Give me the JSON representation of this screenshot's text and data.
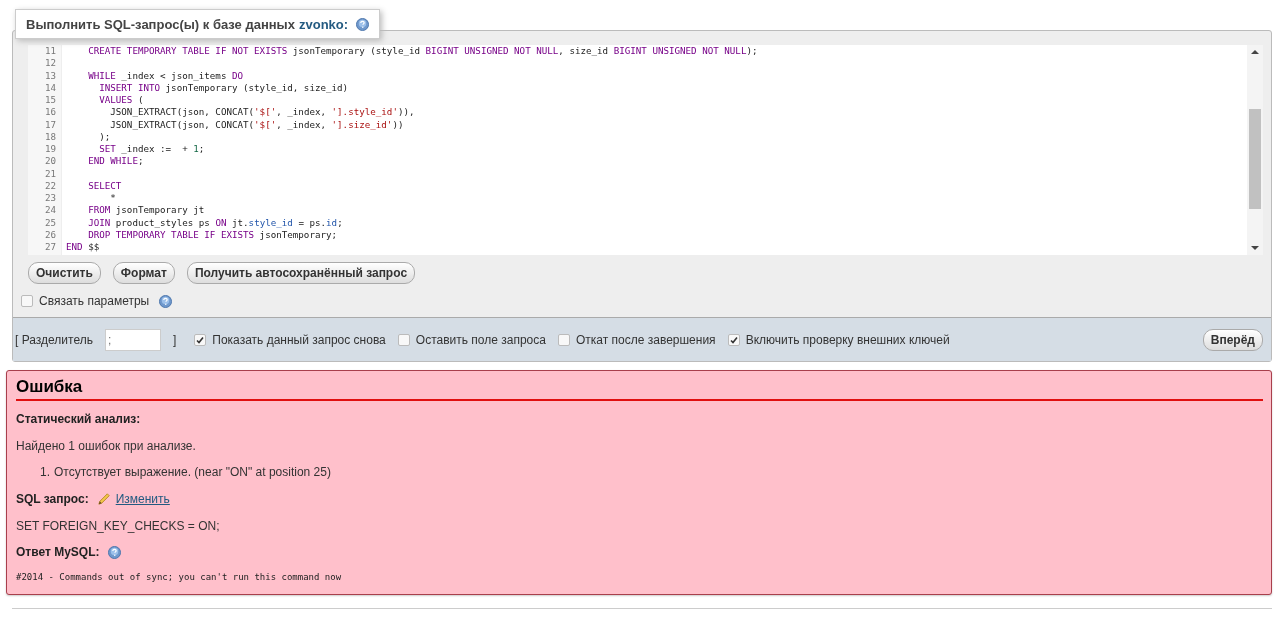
{
  "query_box": {
    "title": "Выполнить SQL-запрос(ы) к базе данных",
    "database": "zvonko:",
    "code_lines": [
      {
        "number": "11",
        "tokens": [
          {
            "kind": "kw",
            "t": "    CREATE TEMPORARY TABLE IF NOT EXISTS"
          },
          {
            "kind": "plain",
            "t": " jsonTemporary (style_id "
          },
          {
            "kind": "kw",
            "t": "BIGINT UNSIGNED NOT NULL"
          },
          {
            "kind": "plain",
            "t": ", size_id "
          },
          {
            "kind": "kw",
            "t": "BIGINT UNSIGNED NOT NULL"
          },
          {
            "kind": "plain",
            "t": ");"
          }
        ]
      },
      {
        "number": "12"
      },
      {
        "number": "13",
        "tokens": [
          {
            "kind": "kw",
            "t": "    WHILE"
          },
          {
            "kind": "plain",
            "t": " _index < json_items "
          },
          {
            "kind": "kw",
            "t": "DO"
          }
        ]
      },
      {
        "number": "14",
        "tokens": [
          {
            "kind": "kw",
            "t": "      INSERT INTO"
          },
          {
            "kind": "plain",
            "t": " jsonTemporary (style_id, size_id)"
          }
        ]
      },
      {
        "number": "15",
        "tokens": [
          {
            "kind": "kw",
            "t": "      VALUES"
          },
          {
            "kind": "plain",
            "t": " ("
          }
        ]
      },
      {
        "number": "16",
        "tokens": [
          {
            "kind": "plain",
            "t": "        JSON_EXTRACT(json, CONCAT("
          },
          {
            "kind": "str",
            "t": "'$['"
          },
          {
            "kind": "plain",
            "t": ", _index, "
          },
          {
            "kind": "str",
            "t": "'].style_id'"
          },
          {
            "kind": "plain",
            "t": ")),"
          }
        ]
      },
      {
        "number": "17",
        "tokens": [
          {
            "kind": "plain",
            "t": "        JSON_EXTRACT(json, CONCAT("
          },
          {
            "kind": "str",
            "t": "'$['"
          },
          {
            "kind": "plain",
            "t": ", _index, "
          },
          {
            "kind": "str",
            "t": "'].size_id'"
          },
          {
            "kind": "plain",
            "t": "))"
          }
        ]
      },
      {
        "number": "18",
        "tokens": [
          {
            "kind": "plain",
            "t": "      );"
          }
        ]
      },
      {
        "number": "19",
        "tokens": [
          {
            "kind": "kw",
            "t": "      SET"
          },
          {
            "kind": "plain",
            "t": " _index :=  + "
          },
          {
            "kind": "num",
            "t": "1"
          },
          {
            "kind": "plain",
            "t": ";"
          }
        ]
      },
      {
        "number": "20",
        "tokens": [
          {
            "kind": "kw",
            "t": "    END WHILE"
          },
          {
            "kind": "plain",
            "t": ";"
          }
        ]
      },
      {
        "number": "21"
      },
      {
        "number": "22",
        "tokens": [
          {
            "kind": "kw",
            "t": "    SELECT"
          }
        ]
      },
      {
        "number": "23",
        "tokens": [
          {
            "kind": "plain",
            "t": "        *"
          }
        ]
      },
      {
        "number": "24",
        "tokens": [
          {
            "kind": "kw",
            "t": "    FROM"
          },
          {
            "kind": "plain",
            "t": " jsonTemporary jt"
          }
        ]
      },
      {
        "number": "25",
        "tokens": [
          {
            "kind": "kw",
            "t": "    JOIN"
          },
          {
            "kind": "plain",
            "t": " product_styles ps "
          },
          {
            "kind": "kw",
            "t": "ON"
          },
          {
            "kind": "plain",
            "t": " jt."
          },
          {
            "kind": "var",
            "t": "style_id"
          },
          {
            "kind": "plain",
            "t": " = ps."
          },
          {
            "kind": "var",
            "t": "id"
          },
          {
            "kind": "plain",
            "t": ";"
          }
        ]
      },
      {
        "number": "26",
        "tokens": [
          {
            "kind": "kw",
            "t": "    DROP TEMPORARY TABLE IF EXISTS"
          },
          {
            "kind": "plain",
            "t": " jsonTemporary;"
          }
        ]
      },
      {
        "number": "27",
        "tokens": [
          {
            "kind": "kw",
            "t": "END"
          },
          {
            "kind": "plain",
            "t": " $$"
          }
        ]
      }
    ],
    "buttons": [
      "Очистить",
      "Формат",
      "Получить автосохранённый запрос"
    ],
    "bind_params": {
      "label": "Связать параметры",
      "checked": false
    }
  },
  "options_bar": {
    "delimiter_label": "[ Разделитель",
    "delimiter": {
      "placeholder": ";"
    },
    "delimiter_close": "]",
    "options": [
      {
        "label": "Показать данный запрос снова",
        "checked": true
      },
      {
        "label": "Оставить поле запроса",
        "checked": false
      },
      {
        "label": "Откат после завершения",
        "checked": false
      },
      {
        "label": "Включить проверку внешних ключей",
        "checked": true
      }
    ],
    "submit": "Вперёд"
  },
  "error": {
    "title": "Ошибка",
    "analysis_heading": "Статический анализ:",
    "summary": "Найдено 1 ошибок при анализе.",
    "issues": [
      {
        "number": "1.",
        "text": "Отсутствует выражение. (near \"ON\" at position 25)"
      }
    ],
    "query_label": "SQL запрос:",
    "edit_link": "Изменить",
    "query": "SET FOREIGN_KEY_CHECKS = ON;",
    "response_label": "Ответ MySQL:",
    "response": "#2014 - Commands out of sync; you can't run this command now"
  }
}
